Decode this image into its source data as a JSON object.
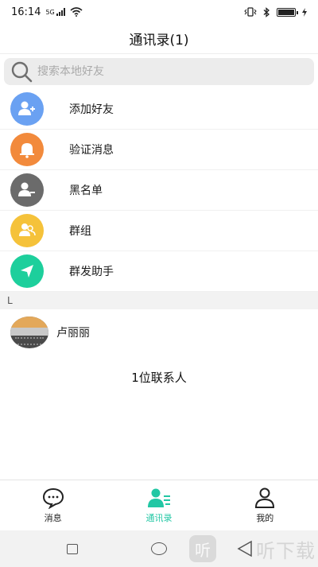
{
  "status_bar": {
    "time": "16:14",
    "signal_label": "5G"
  },
  "header": {
    "title": "通讯录(1)"
  },
  "search": {
    "placeholder": "搜索本地好友"
  },
  "menu": {
    "items": [
      {
        "label": "添加好友",
        "icon": "add-user-icon",
        "color": "#6aa1f2"
      },
      {
        "label": "验证消息",
        "icon": "bell-icon",
        "color": "#f28a3c"
      },
      {
        "label": "黑名单",
        "icon": "remove-user-icon",
        "color": "#6b6b6b"
      },
      {
        "label": "群组",
        "icon": "group-icon",
        "color": "#f5c23a"
      },
      {
        "label": "群发助手",
        "icon": "send-icon",
        "color": "#1dcf9c"
      }
    ]
  },
  "contacts": {
    "section_letter": "L",
    "items": [
      {
        "name": "卢丽丽"
      }
    ],
    "count_text": "1位联系人"
  },
  "tab_bar": {
    "tabs": [
      {
        "label": "消息",
        "icon": "chat-bubble-icon",
        "active": false
      },
      {
        "label": "通讯录",
        "icon": "contacts-icon",
        "active": true
      },
      {
        "label": "我的",
        "icon": "profile-icon",
        "active": false
      }
    ],
    "active_color": "#22c7a4"
  },
  "watermark": {
    "badge": "听",
    "text": "听下载"
  }
}
